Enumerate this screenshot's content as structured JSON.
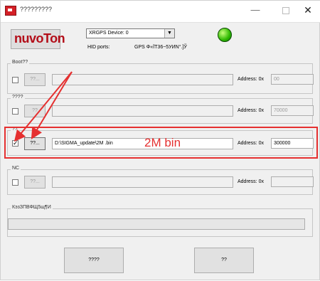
{
  "window": {
    "title": "?????????",
    "minimize_label": "—",
    "close_label": "✕"
  },
  "header": {
    "logo_text": "nuvoTon",
    "device_select_value": "XRGPS Device: 0",
    "hid_label": "HID ports:",
    "hid_value": "GPS Φ«ÏΤ36~5УИN°.]Ў",
    "status_color": "#2db800"
  },
  "groups": [
    {
      "title": "Boot??",
      "checked": false,
      "browse_label": "??...",
      "path": "",
      "address_label": "Address: 0x",
      "address_value": "00"
    },
    {
      "title": "????",
      "checked": false,
      "browse_label": "??",
      "path": "",
      "address_label": "Address: 0x",
      "address_value": "70000"
    },
    {
      "title": "??",
      "checked": true,
      "browse_label": "??...",
      "path": "D:\\SIGMA_update\\2M .bin",
      "address_label": "Address: 0x",
      "address_value": "300000"
    },
    {
      "title": "NC",
      "checked": false,
      "browse_label": "??...",
      "path": "",
      "address_label": "Address: 0x",
      "address_value": ""
    }
  ],
  "annotation": {
    "text": "2M bin",
    "color": "#e53030"
  },
  "progress_group": {
    "title": "КэзЗПВФЩ5щ¶И"
  },
  "buttons": {
    "left_label": "????",
    "right_label": "??"
  }
}
